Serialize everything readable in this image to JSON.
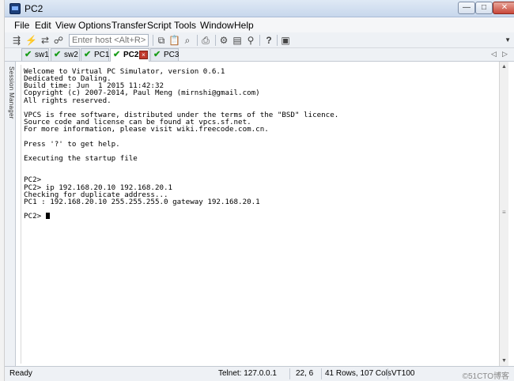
{
  "window": {
    "title": "PC2",
    "minimize_glyph": "—",
    "maximize_glyph": "□",
    "close_glyph": "✕"
  },
  "menu": [
    "File",
    "Edit",
    "View",
    "Options",
    "Transfer",
    "Script",
    "Tools",
    "Window",
    "Help"
  ],
  "toolbar": {
    "host_placeholder": "Enter host <Alt+R>"
  },
  "tabs": [
    {
      "label": "sw1",
      "status": "connected"
    },
    {
      "label": "sw2",
      "status": "connected"
    },
    {
      "label": "PC1",
      "status": "connected"
    },
    {
      "label": "PC2",
      "status": "connected",
      "active": true
    },
    {
      "label": "PC3",
      "status": "connected"
    }
  ],
  "side_panel": {
    "label": "Session Manager"
  },
  "terminal": {
    "lines": [
      "Welcome to Virtual PC Simulator, version 0.6.1",
      "Dedicated to Daling.",
      "Build time: Jun  1 2015 11:42:32",
      "Copyright (c) 2007-2014, Paul Meng (mirnshi@gmail.com)",
      "All rights reserved.",
      "",
      "VPCS is free software, distributed under the terms of the \"BSD\" licence.",
      "Source code and license can be found at vpcs.sf.net.",
      "For more information, please visit wiki.freecode.com.cn.",
      "",
      "Press '?' to get help.",
      "",
      "Executing the startup file",
      "",
      "",
      "PC2>",
      "PC2> ip 192.168.20.10 192.168.20.1",
      "Checking for duplicate address...",
      "PC1 : 192.168.20.10 255.255.255.0 gateway 192.168.20.1",
      ""
    ],
    "prompt": "PC2> "
  },
  "statusbar": {
    "state": "Ready",
    "connection": "Telnet: 127.0.0.1",
    "cursor_pos": "22,  6",
    "size": "41 Rows, 107 Cols",
    "emulation": "VT100",
    "watermark": "©51CTO博客"
  },
  "colors": {
    "check_green": "#1a9c1a",
    "close_red": "#c0392b"
  }
}
